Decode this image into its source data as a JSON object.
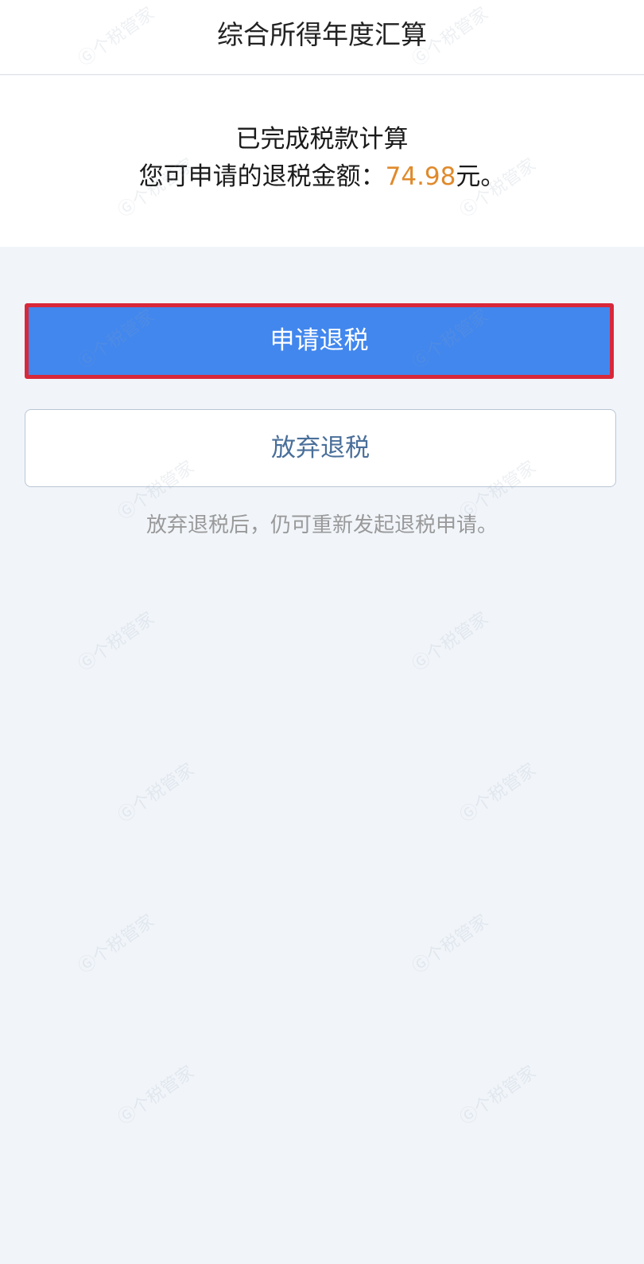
{
  "header": {
    "title": "综合所得年度汇算"
  },
  "result": {
    "status_text": "已完成税款计算",
    "amount_label": "您可申请的退税金额：",
    "amount_value": "74.98",
    "amount_unit": "元。"
  },
  "actions": {
    "apply_label": "申请退税",
    "abandon_label": "放弃退税",
    "hint": "放弃退税后，仍可重新发起退税申请。"
  },
  "watermark": {
    "text": "个税管家"
  },
  "colors": {
    "primary_button": "#4287ee",
    "amount_highlight": "#e08a2c",
    "annotation_box": "#d8283a",
    "secondary_text": "#4a6f9a"
  }
}
